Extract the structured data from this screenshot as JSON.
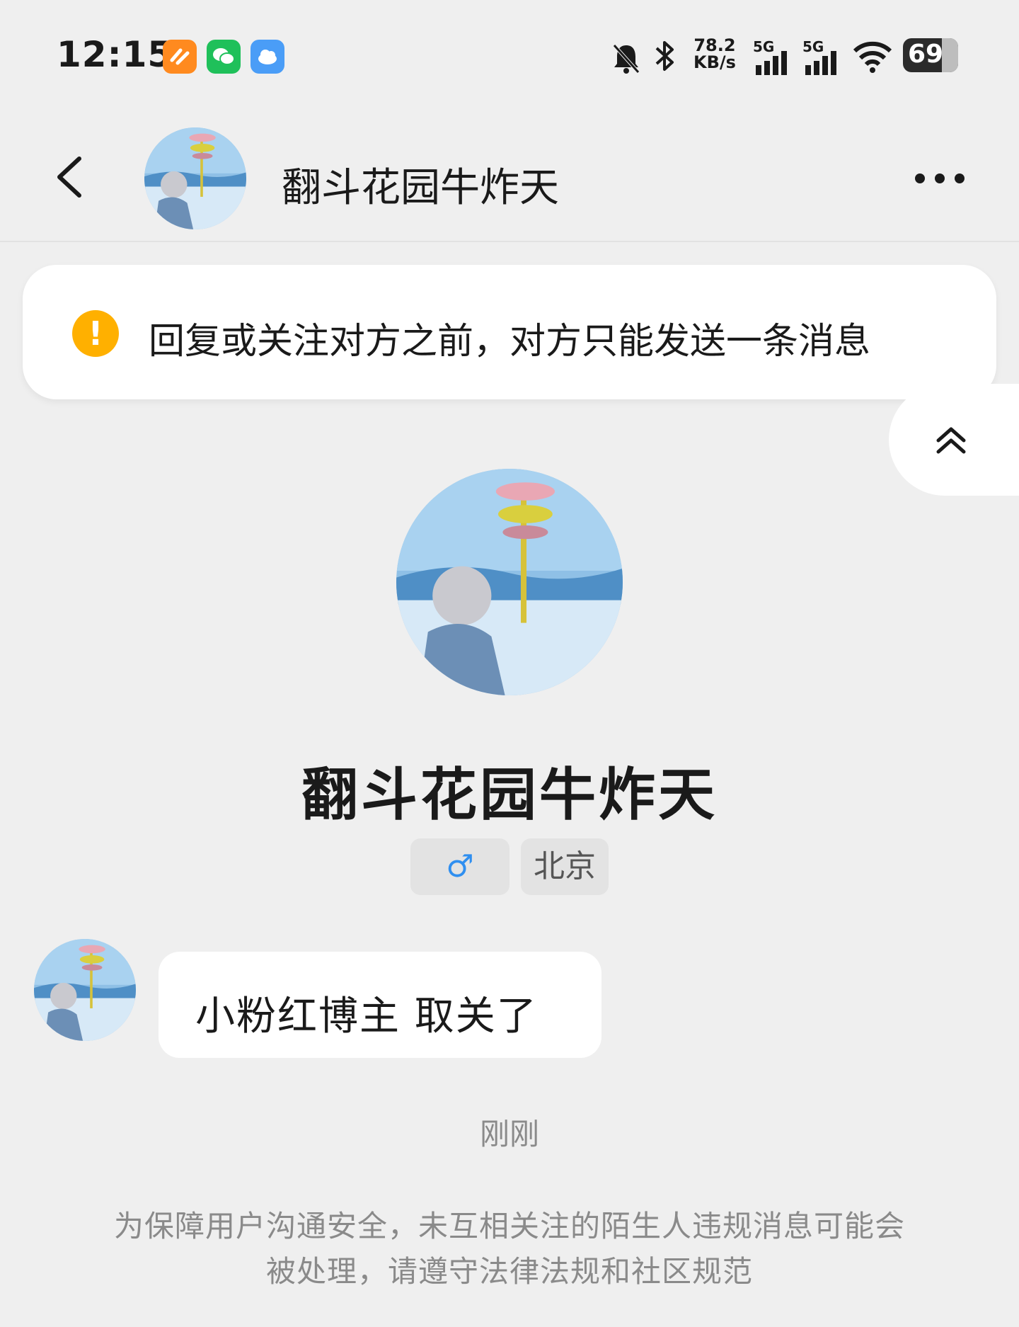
{
  "status_bar": {
    "time": "12:15",
    "speed_value": "78.2",
    "speed_unit": "KB/s",
    "network_1": "5G",
    "network_2": "5G",
    "battery": "69",
    "icons": [
      "app-orange-icon",
      "wechat-icon",
      "weather-icon",
      "mute-bell-icon",
      "bluetooth-icon",
      "signal-icon",
      "signal-icon",
      "wifi-icon",
      "battery-icon"
    ]
  },
  "header": {
    "title": "翻斗花园牛炸天",
    "back_icon": "chevron-left-icon",
    "more_icon": "more-dots-icon"
  },
  "notice": {
    "text": "回复或关注对方之前，对方只能发送一条消息",
    "icon": "warning-icon",
    "accent": "#ffb000"
  },
  "scroll_button": {
    "icon": "double-chevron-up-icon"
  },
  "profile": {
    "name": "翻斗花园牛炸天",
    "gender": "♂",
    "gender_color": "#2f8ff0",
    "city": "北京"
  },
  "message": {
    "text": "小粉红博主 取关了",
    "time": "刚刚"
  },
  "footer_note": "为保障用户沟通安全，未互相关注的陌生人违规消息可能会被处理，请遵守法律法规和社区规范"
}
